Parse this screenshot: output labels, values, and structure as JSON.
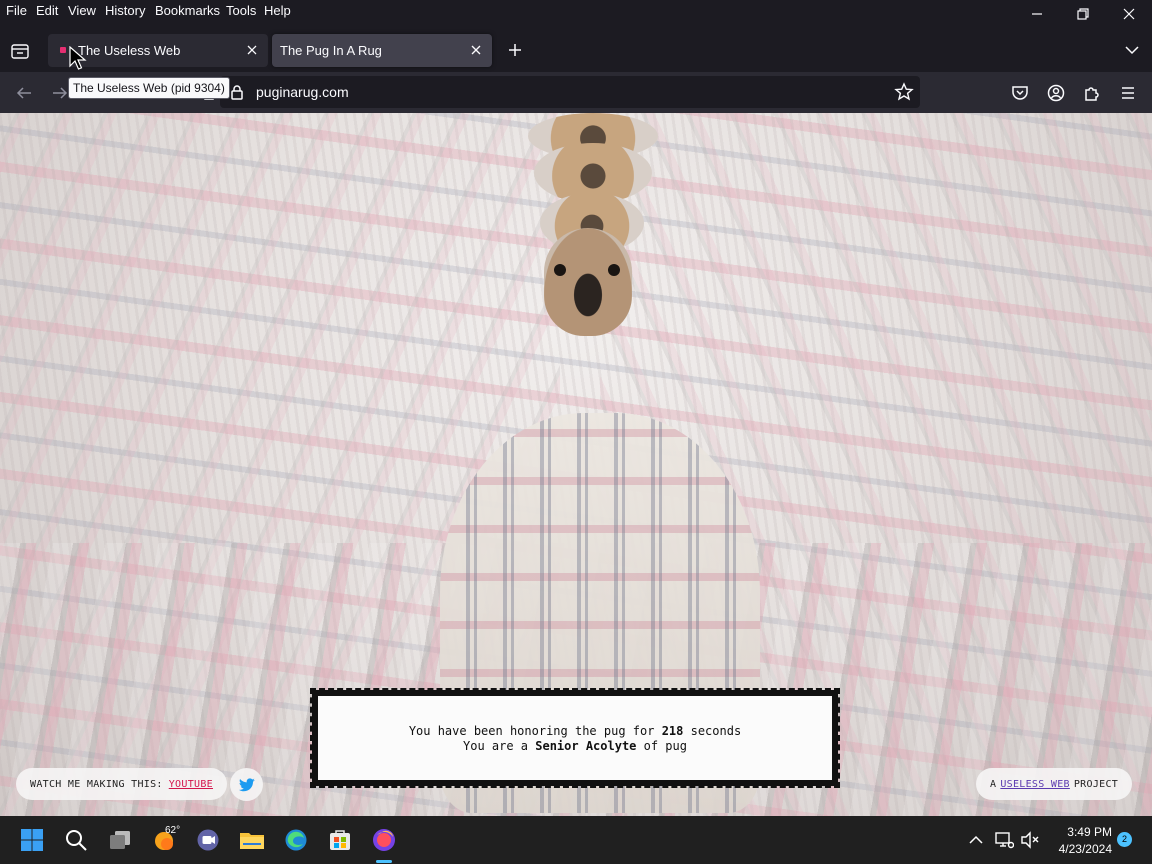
{
  "menu": {
    "items": [
      "File",
      "Edit",
      "View",
      "History",
      "Bookmarks",
      "Tools",
      "Help"
    ]
  },
  "tabs": [
    {
      "title": "The Useless Web"
    },
    {
      "title": "The Pug In A Rug"
    }
  ],
  "tooltip": "The Useless Web (pid 9304)",
  "urlbar": {
    "url": "puginarug.com"
  },
  "page": {
    "line1_prefix": "You have been honoring the pug for ",
    "seconds": "218",
    "line1_suffix": " seconds",
    "line2_prefix": "You are a ",
    "rank": "Senior Acolyte",
    "line2_suffix": " of pug",
    "watch_label": "WATCH ME MAKING THIS:",
    "youtube_link": "YOUTUBE",
    "project_prefix": "A",
    "useless_web_link": "USELESS WEB",
    "project_suffix": "PROJECT"
  },
  "taskbar": {
    "weather_temp": "62°",
    "time": "3:49 PM",
    "date": "4/23/2024",
    "notification_count": "2"
  },
  "colors": {
    "browser_bg": "#1c1b22",
    "toolbar_bg": "#2b2a33",
    "active_tab": "#42414d",
    "youtube_link": "#d4144c",
    "useless_web_link": "#5b3ab0",
    "taskbar_bg": "#202020",
    "favicon": "#e52e71"
  }
}
